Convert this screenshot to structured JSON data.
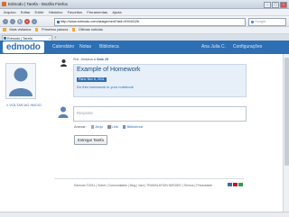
{
  "browser": {
    "window_title": "Edmodo | Tarefa - Mozilla Firefox",
    "menu": [
      "Arquivo",
      "Editar",
      "Exibir",
      "Histórico",
      "Favoritos",
      "Ferramentas",
      "Ajuda"
    ],
    "url": "http://www.edmodo.com/assignment?aid=4944412b",
    "search_placeholder": "Google",
    "bookmarks": [
      "Mais visitados",
      "Primeiros passos",
      "Últimas notícias"
    ],
    "tab_label": "Edmodo | Tarefa"
  },
  "colors": {
    "brand": "#2e6fb3",
    "card_bg": "#e7eff8",
    "due_badge": "#2e6fb3"
  },
  "edmodo": {
    "logo": "edmodo",
    "nav": {
      "calendar": "Calendário",
      "notes": "Notas",
      "library": "Biblioteca",
      "user": "Ana Julia C.",
      "settings": "Configurações"
    },
    "back_link": "« VOLTAR AO INICIO",
    "post": {
      "sender_prefix": "Sra. Jordana a",
      "sender_target": "Sala 25",
      "title": "Example of Homework",
      "due": "Para: Nov 6, 2011",
      "description": "Do this homework in your notebook"
    },
    "reply_placeholder": "Resposta",
    "attach": {
      "label": "Anexar:",
      "file": "Arqu",
      "link": "Link",
      "library": "Biblioteca"
    },
    "submit_label": "Entregar Tarefa",
    "footer": "Edmodo ©2011 | Sobre | Comunidades | Blog | Vaxi | TRANSLATION NEEDED | Termos | Privacidade"
  }
}
